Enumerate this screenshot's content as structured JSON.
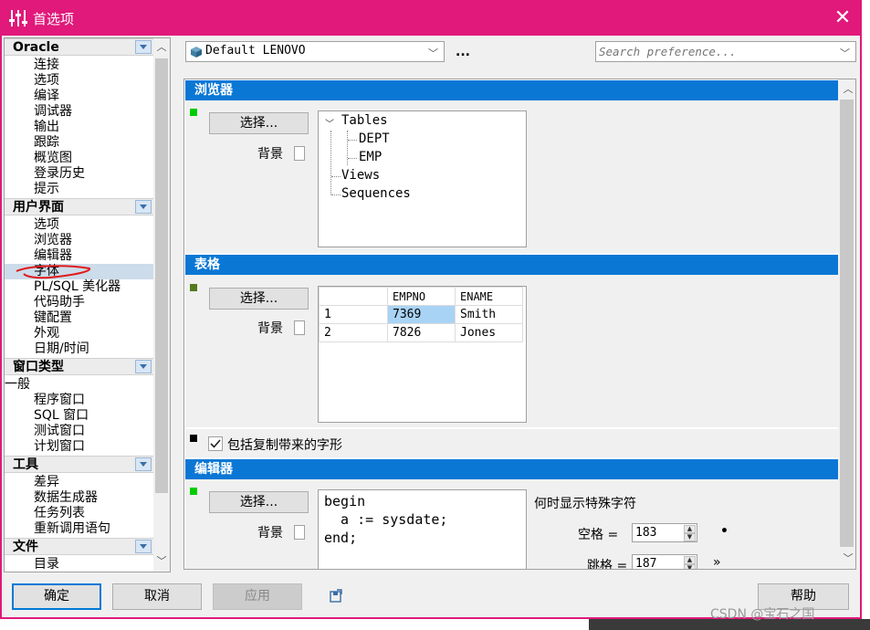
{
  "window": {
    "title": "首选项",
    "close_glyph": "✕"
  },
  "nav": {
    "sections": [
      {
        "label": "Oracle",
        "items": [
          "连接",
          "选项",
          "编译",
          "调试器",
          "输出",
          "跟踪",
          "概览图",
          "登录历史",
          "提示"
        ]
      },
      {
        "label": "用户界面",
        "items": [
          "选项",
          "浏览器",
          "编辑器",
          "字体",
          "PL/SQL 美化器",
          "代码助手",
          "键配置",
          "外观",
          "日期/时间"
        ]
      },
      {
        "label": "窗口类型",
        "items": [
          "一般",
          "程序窗口",
          "SQL 窗口",
          "测试窗口",
          "计划窗口"
        ]
      },
      {
        "label": "工具",
        "items": [
          "差异",
          "数据生成器",
          "任务列表",
          "重新调用语句"
        ]
      },
      {
        "label": "文件",
        "items": [
          "目录"
        ]
      }
    ],
    "selected": "字体"
  },
  "toolbar": {
    "profile": "Default LENOVO",
    "more": "...",
    "search_placeholder": "Search preference..."
  },
  "browser_section": {
    "header": "浏览器",
    "select_btn": "选择...",
    "bg_label": "背景",
    "indicator_color": "#00cc00",
    "tree": {
      "root": "Tables",
      "children": [
        "DEPT",
        "EMP"
      ],
      "siblings": [
        "Views",
        "Sequences"
      ]
    }
  },
  "table_section": {
    "header": "表格",
    "select_btn": "选择...",
    "bg_label": "背景",
    "indicator_color": "#557a1e",
    "columns": [
      "EMPNO",
      "ENAME"
    ],
    "rows": [
      [
        "1",
        "7369",
        "Smith"
      ],
      [
        "2",
        "7826",
        "Jones"
      ]
    ]
  },
  "include_checkbox": {
    "label": "包括复制带来的字形",
    "checked": true,
    "indicator_color": "#000000"
  },
  "editor_section": {
    "header": "编辑器",
    "select_btn": "选择...",
    "bg_label": "背景",
    "indicator_color": "#00cc00",
    "code": [
      "begin",
      "  a := sysdate;",
      "end;"
    ],
    "special_chars_label": "何时显示特殊字符",
    "space_label": "空格 =",
    "space_value": "183",
    "space_glyph": "•",
    "tab_label": "跳格 =",
    "tab_value": "187",
    "tab_glyph": "»"
  },
  "buttons": {
    "ok": "确定",
    "cancel": "取消",
    "apply": "应用",
    "help": "帮助"
  },
  "watermark": "CSDN @宝石之国",
  "colors": {
    "titlebar": "#e0197a",
    "section_header": "#0a77d5",
    "selection": "#cddcea"
  }
}
